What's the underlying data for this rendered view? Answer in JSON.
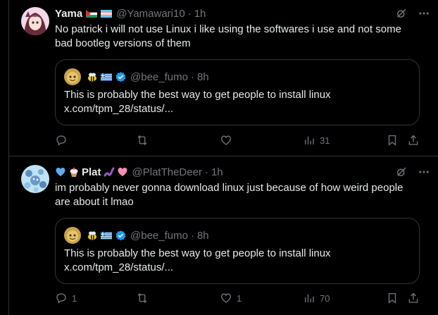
{
  "tweets": [
    {
      "name": "Yama",
      "handle": "@Yamawari10",
      "dot": "·",
      "time": "1h",
      "text": "No patrick i will not use Linux i like using the softwares i use and not some bad bootleg versions of them",
      "quote": {
        "handle": "@bee_fumo",
        "dot": "·",
        "time": "8h",
        "line1": "This is probably the best way to get people to install linux",
        "line2": "x.com/tpm_28/status/..."
      },
      "replies": "",
      "reposts": "",
      "likes": "",
      "views": "31"
    },
    {
      "name": "Plat",
      "handle": "@PlatTheDeer",
      "dot": "·",
      "time": "1h",
      "text": "im probably never gonna download linux just because of how weird people are about it lmao",
      "quote": {
        "handle": "@bee_fumo",
        "dot": "·",
        "time": "8h",
        "line1": "This is probably the best way to get people to install linux",
        "line2": "x.com/tpm_28/status/..."
      },
      "replies": "1",
      "reposts": "",
      "likes": "1",
      "views": "70"
    }
  ],
  "colors": {
    "background": "#000000",
    "text": "#e7e9ea",
    "muted": "#71767b",
    "border": "#2f3336",
    "verified": "#1d9bf0"
  }
}
